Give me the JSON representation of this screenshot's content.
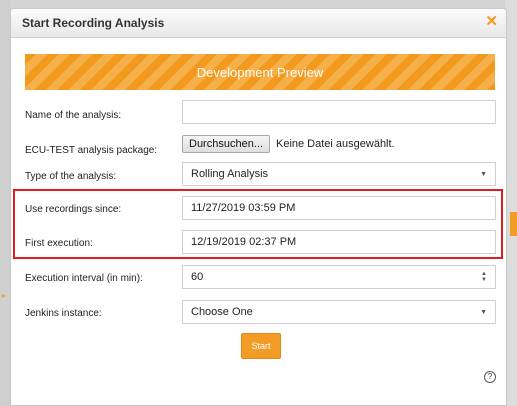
{
  "dialog": {
    "title": "Start Recording Analysis",
    "close_icon": "close-icon",
    "banner": "Development Preview"
  },
  "form": {
    "name": {
      "label": "Name of the analysis:",
      "value": ""
    },
    "package": {
      "label": "ECU-TEST analysis package:",
      "browse_label": "Durchsuchen...",
      "status": "Keine Datei ausgewählt."
    },
    "type": {
      "label": "Type of the analysis:",
      "value": "Rolling Analysis"
    },
    "since": {
      "label": "Use recordings since:",
      "value": "11/27/2019 03:59 PM"
    },
    "first_execution": {
      "label": "First execution:",
      "value": "12/19/2019 02:37 PM"
    },
    "interval": {
      "label": "Execution interval (in min):",
      "value": "60"
    },
    "jenkins": {
      "label": "Jenkins instance:",
      "value": "Choose One"
    },
    "start_label": "Start",
    "help_glyph": "?"
  },
  "colors": {
    "accent": "#f29b25",
    "highlight": "#e02020"
  }
}
